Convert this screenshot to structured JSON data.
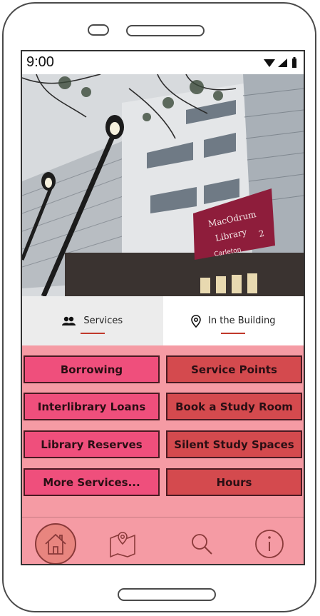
{
  "status": {
    "time": "9:00"
  },
  "hero": {
    "sign_line1": "MacOdrum",
    "sign_line2": "Library",
    "sign_number": "2",
    "sign_brand": "Carleton"
  },
  "tabs": [
    {
      "label": "Services",
      "icon": "people-icon",
      "active": true
    },
    {
      "label": "In the Building",
      "icon": "map-pin-icon",
      "active": false
    }
  ],
  "services": {
    "left": [
      "Borrowing",
      "Interlibrary Loans",
      "Library Reserves",
      "More Services..."
    ],
    "right": [
      "Service Points",
      "Book a Study Room",
      "Silent Study Spaces",
      "Hours"
    ]
  },
  "nav": [
    "home-icon",
    "map-icon",
    "search-icon",
    "info-icon"
  ],
  "colors": {
    "screen_bg": "#f59ba4",
    "left_button": "#ef4f7c",
    "right_button": "#d44a4e",
    "tab_indicator": "#c0392b"
  }
}
